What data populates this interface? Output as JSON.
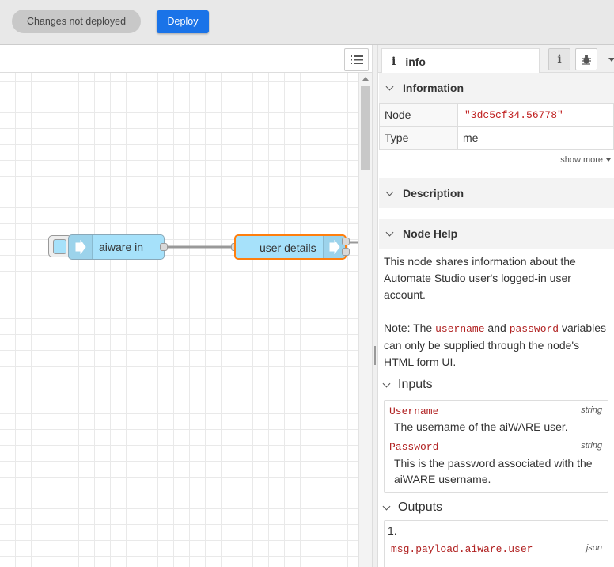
{
  "topbar": {
    "status_pill": "Changes not deployed",
    "deploy_label": "Deploy"
  },
  "workspace": {
    "nodes": {
      "aiware_in": "aiware in",
      "user_details": "user details"
    },
    "colors": {
      "node_fill": "#a6e1fa",
      "selected_border": "#ff7f0e",
      "wire": "#999999"
    }
  },
  "sidebar": {
    "tab_label": "info",
    "tab_icon": "info-icon",
    "information": {
      "title": "Information",
      "rows": [
        {
          "key": "Node",
          "value": "\"3dc5cf34.56778\""
        },
        {
          "key": "Type",
          "value": "me"
        }
      ],
      "show_more": "show more"
    },
    "description": {
      "title": "Description"
    },
    "node_help": {
      "title": "Node Help",
      "intro": "This node shares information about the Automate Studio user's logged-in user account.",
      "note_prefix": "Note: The ",
      "note_code1": "username",
      "note_mid": " and ",
      "note_code2": "password",
      "note_suffix": " variables can only be supplied through the node's HTML form UI.",
      "inputs_title": "Inputs",
      "inputs": [
        {
          "name": "Username",
          "type": "string",
          "desc": "The username of the aiWARE user."
        },
        {
          "name": "Password",
          "type": "string",
          "desc": "This is the password associated with the aiWARE username."
        }
      ],
      "outputs_title": "Outputs",
      "outputs": [
        {
          "index": "1.",
          "name": "msg.payload.aiware.user",
          "type": "json"
        }
      ]
    }
  }
}
